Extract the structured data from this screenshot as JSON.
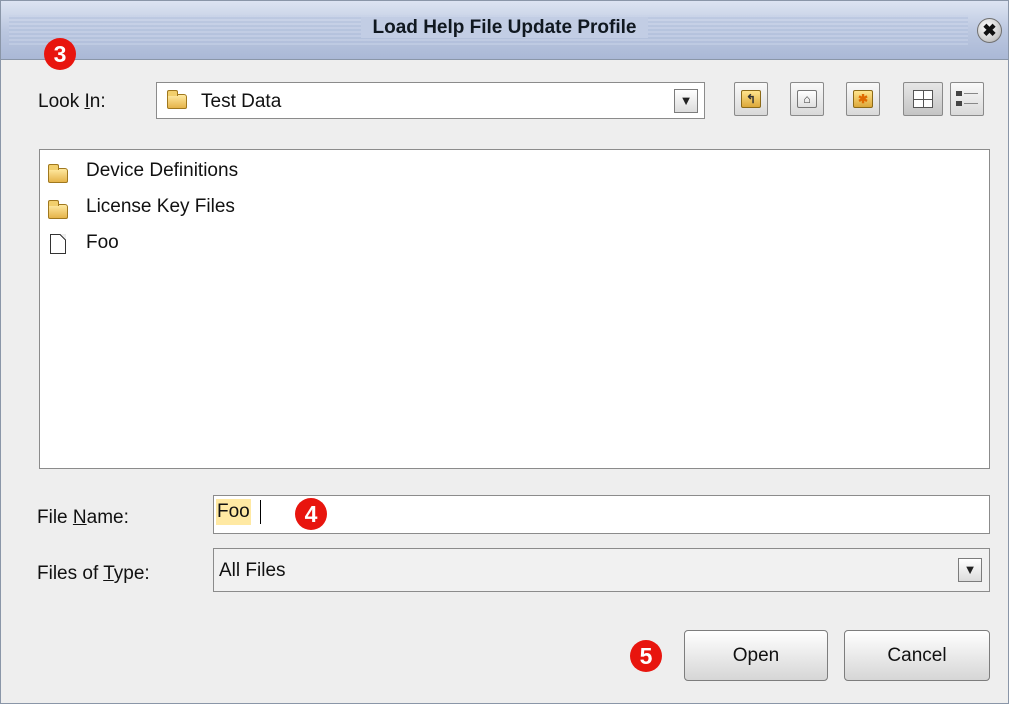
{
  "window": {
    "title": "Load Help File Update Profile",
    "close_glyph": "✖"
  },
  "callouts": {
    "three": "3",
    "four": "4",
    "five": "5"
  },
  "look_in": {
    "label_before": "Look ",
    "label_mnemonic": "I",
    "label_after": "n:",
    "value": "Test Data",
    "icon": "folder-icon"
  },
  "toolbar": {
    "up_one_level_icon": "folder-up-icon",
    "home_icon": "home-icon",
    "new_folder_icon": "new-folder-icon",
    "list_view_icon": "list-view-icon",
    "details_view_icon": "details-view-icon"
  },
  "files": [
    {
      "name": "Device Definitions",
      "type": "folder"
    },
    {
      "name": "License Key Files",
      "type": "folder"
    },
    {
      "name": "Foo",
      "type": "file"
    }
  ],
  "file_name": {
    "label_before": "File ",
    "label_mnemonic": "N",
    "label_after": "ame:",
    "value": "Foo"
  },
  "file_type": {
    "label_before": "Files of ",
    "label_mnemonic": "T",
    "label_after": "ype:",
    "value": "All Files"
  },
  "buttons": {
    "open": "Open",
    "cancel": "Cancel"
  },
  "colors": {
    "callout": "#e8150e",
    "selection": "#ffe9a3",
    "titlebar": "#bcc8e0"
  }
}
